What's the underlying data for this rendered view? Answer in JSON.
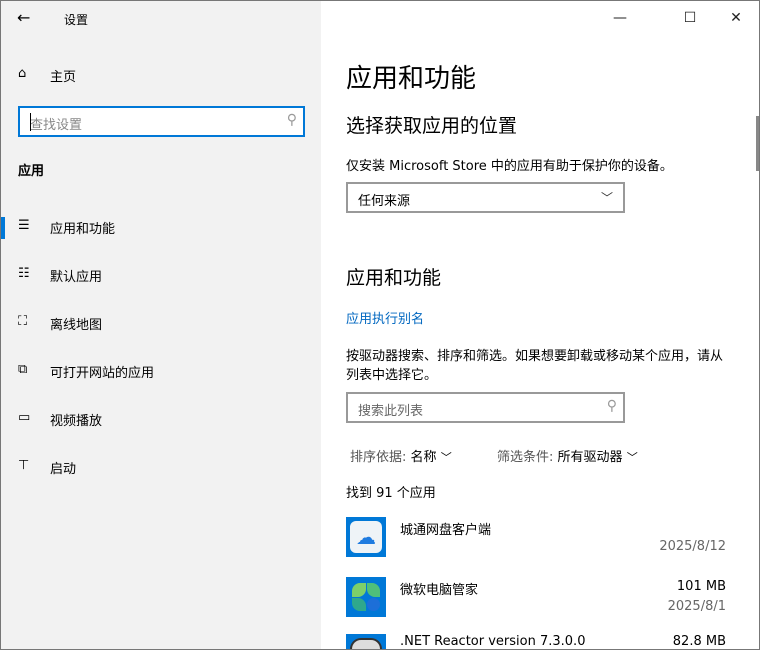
{
  "window": {
    "title": "设置",
    "minimize": "—",
    "maximize": "☐",
    "close": "✕"
  },
  "sidebar": {
    "home": "主页",
    "search_placeholder": "查找设置",
    "section": "应用",
    "items": [
      {
        "label": "应用和功能",
        "icon": "list-icon",
        "glyph": "☰",
        "selected": true
      },
      {
        "label": "默认应用",
        "icon": "default-apps-icon",
        "glyph": "☷"
      },
      {
        "label": "离线地图",
        "icon": "map-icon",
        "glyph": "⛶"
      },
      {
        "label": "可打开网站的应用",
        "icon": "open-web-icon",
        "glyph": "⧉"
      },
      {
        "label": "视频播放",
        "icon": "video-icon",
        "glyph": "▭"
      },
      {
        "label": "启动",
        "icon": "startup-icon",
        "glyph": "⊤"
      }
    ]
  },
  "main": {
    "title": "应用和功能",
    "source_heading": "选择获取应用的位置",
    "source_desc": "仅安装 Microsoft Store 中的应用有助于保护你的设备。",
    "source_value": "任何来源",
    "apps_heading": "应用和功能",
    "alias_link": "应用执行别名",
    "apps_desc": "按驱动器搜索、排序和筛选。如果想要卸载或移动某个应用，请从列表中选择它。",
    "list_search_placeholder": "搜索此列表",
    "sort_label": "排序依据:",
    "sort_value": "名称",
    "filter_label": "筛选条件:",
    "filter_value": "所有驱动器",
    "count": "找到 91 个应用",
    "apps": [
      {
        "name": "城通网盘客户端",
        "size": "",
        "date": "2025/8/12"
      },
      {
        "name": "微软电脑管家",
        "size": "101 MB",
        "date": "2025/8/1"
      },
      {
        "name": ".NET Reactor version 7.3.0.0",
        "size": "82.8 MB",
        "date": ""
      }
    ]
  },
  "colors": {
    "accent": "#0078d7",
    "link": "#0067c0",
    "sidebar_bg": "#f2f2f2"
  }
}
